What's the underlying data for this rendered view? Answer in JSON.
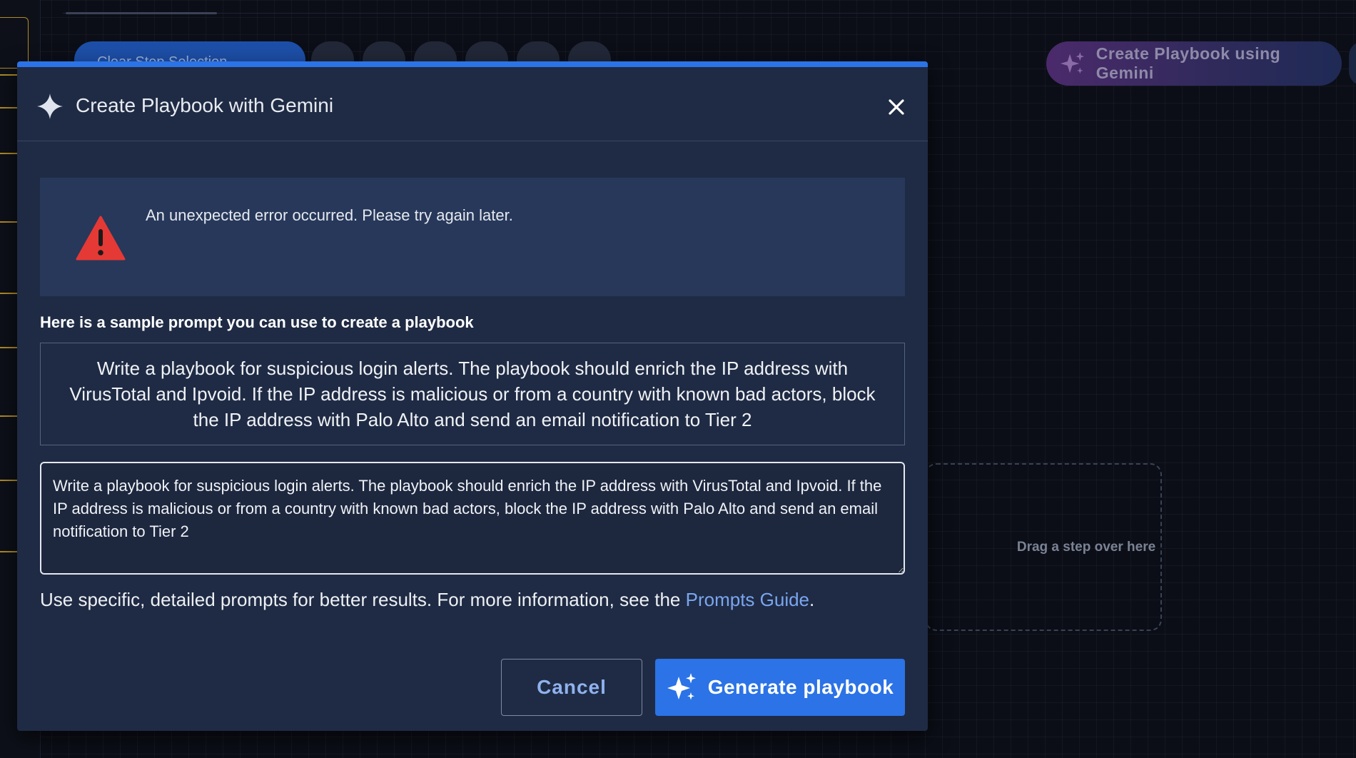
{
  "background": {
    "toolbar_pill_label": "Clear Step Selection",
    "create_with_gemini_label": "Create Playbook using Gemini",
    "drop_zone_label": "Drag a step over here"
  },
  "modal": {
    "title": "Create Playbook with Gemini",
    "error_message": "An unexpected error occurred. Please try again later.",
    "sample_label": "Here is a sample prompt you can use to create a playbook",
    "sample_prompt": "Write a playbook for suspicious login alerts. The playbook should enrich the IP address with VirusTotal and Ipvoid. If the IP address is malicious or from a country with known bad actors, block the IP address with Palo Alto and send an email notification to Tier 2",
    "prompt_value": "Write a playbook for suspicious login alerts. The playbook should enrich the IP address with VirusTotal and Ipvoid. If the IP address is malicious or from a country with known bad actors, block the IP address with Palo Alto and send an email notification to Tier 2",
    "hint_text": "Use specific, detailed prompts for better results. For more information, see the ",
    "hint_link": "Prompts Guide",
    "hint_end": ".",
    "cancel_label": "Cancel",
    "generate_label": "Generate playbook"
  },
  "colors": {
    "accent": "#2b73e6",
    "modal_bg": "#1f2b44",
    "error_icon": "#e53935",
    "link": "#7aa6f0"
  },
  "icons": {
    "header": "gemini-star-icon",
    "close": "close-icon",
    "warning": "warning-triangle-icon",
    "generate": "sparkle-icon"
  }
}
